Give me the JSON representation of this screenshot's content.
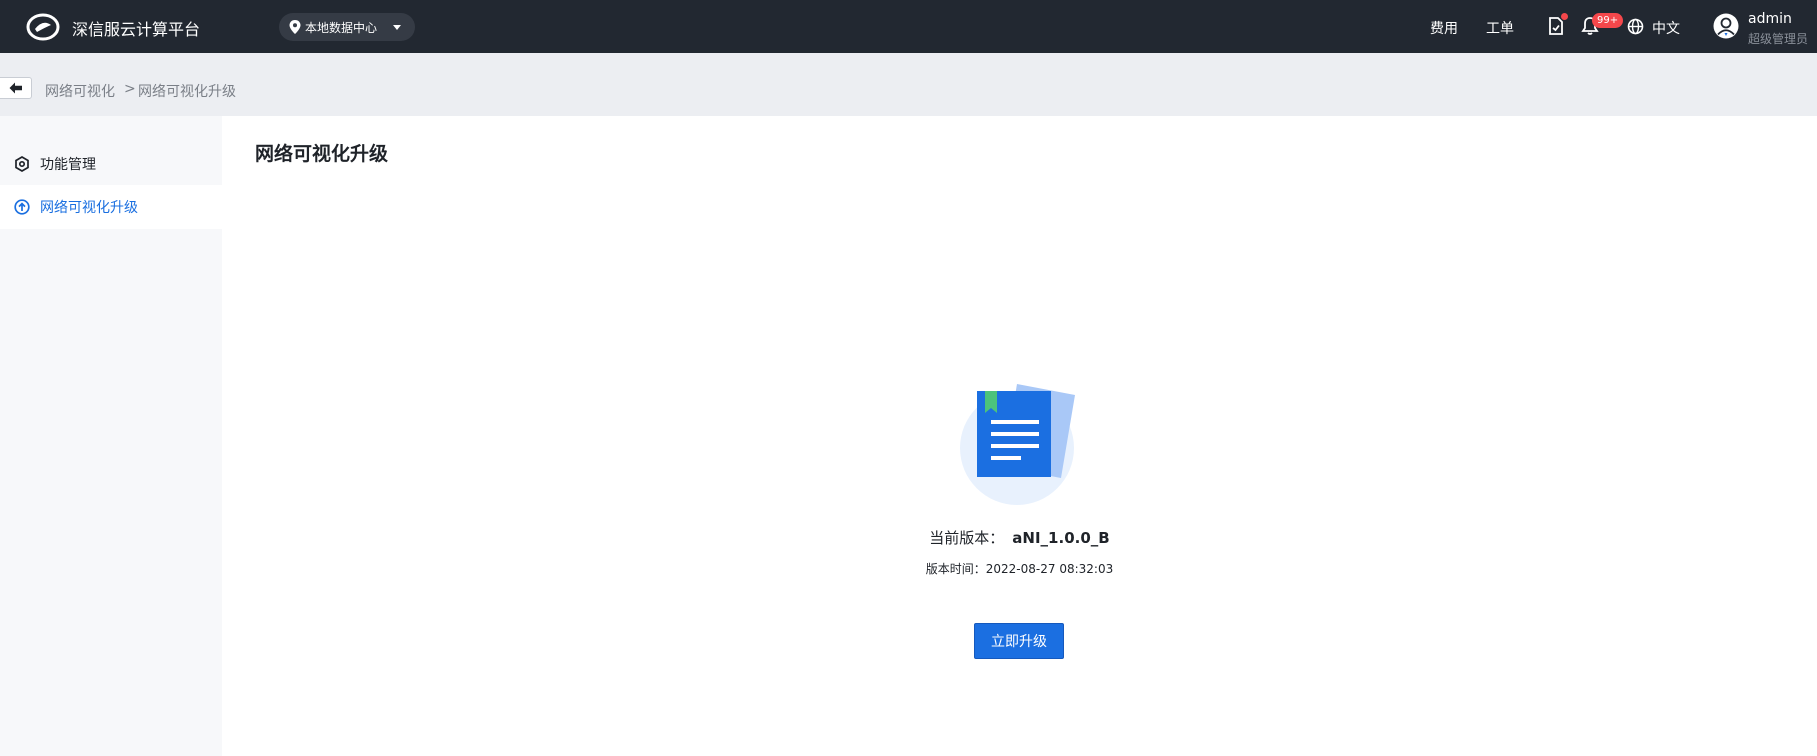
{
  "header": {
    "brand": "深信服云计算平台",
    "datacenter": "本地数据中心",
    "nav_fee": "费用",
    "nav_ticket": "工单",
    "notification_badge": "99+",
    "language": "中文",
    "user_name": "admin",
    "user_role": "超级管理员"
  },
  "breadcrumb": {
    "item1": "网络可视化",
    "separator": ">",
    "item2": "网络可视化升级"
  },
  "sidebar": {
    "items": [
      {
        "label": "功能管理",
        "icon": "hexagon-settings-icon",
        "active": false
      },
      {
        "label": "网络可视化升级",
        "icon": "upgrade-arrow-icon",
        "active": true
      }
    ]
  },
  "main": {
    "title": "网络可视化升级",
    "version_label": "当前版本：",
    "version_value": "aNI_1.0.0_B",
    "version_time": "版本时间：2022-08-27 08:32:03",
    "upgrade_button": "立即升级"
  },
  "colors": {
    "topbar": "#222831",
    "accent": "#1b6fe1",
    "badge": "#f5474b"
  }
}
